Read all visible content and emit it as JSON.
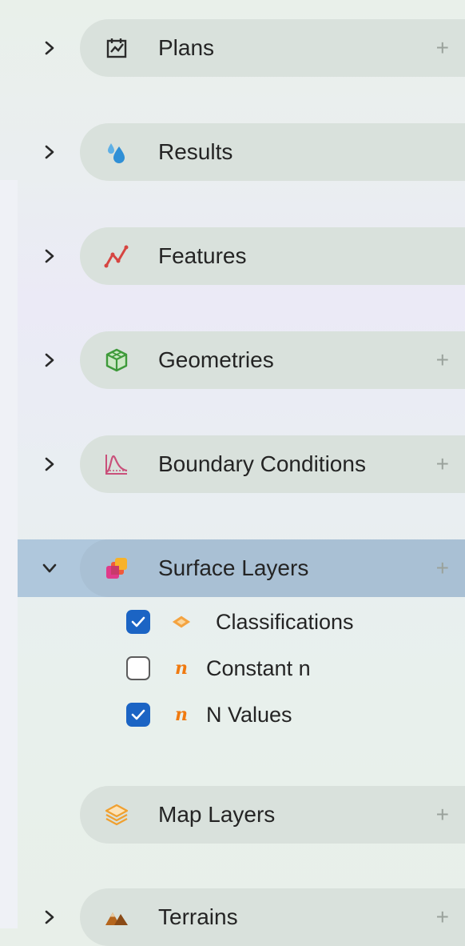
{
  "tree": {
    "plans": {
      "label": "Plans",
      "icon": "plans-icon",
      "expanded": false,
      "has_add": true
    },
    "results": {
      "label": "Results",
      "icon": "water-drops-icon",
      "expanded": false,
      "has_add": false
    },
    "features": {
      "label": "Features",
      "icon": "features-line-icon",
      "expanded": false,
      "has_add": false
    },
    "geometries": {
      "label": "Geometries",
      "icon": "cube-icon",
      "expanded": false,
      "has_add": true
    },
    "boundary_conditions": {
      "label": "Boundary Conditions",
      "icon": "hydrograph-icon",
      "expanded": false,
      "has_add": true
    },
    "surface_layers": {
      "label": "Surface Layers",
      "icon": "surface-layers-icon",
      "expanded": true,
      "selected": true,
      "has_add": true,
      "children": [
        {
          "label": "Classifications",
          "checked": true,
          "icon": "diamond-layer-icon"
        },
        {
          "label": "Constant n",
          "checked": false,
          "icon": "n-icon",
          "icon_text": "n"
        },
        {
          "label": "N Values",
          "checked": true,
          "icon": "n-icon",
          "icon_text": "n"
        }
      ]
    },
    "map_layers": {
      "label": "Map Layers",
      "icon": "stacked-layers-icon",
      "has_add": true
    },
    "terrains": {
      "label": "Terrains",
      "icon": "mountains-icon",
      "expanded": false,
      "has_add": true
    },
    "add_symbol": "+"
  },
  "colors": {
    "accent": "#1b64c4",
    "selection": "#afc7dc",
    "pill": "#d9e1dc",
    "orange": "#f07a10"
  }
}
